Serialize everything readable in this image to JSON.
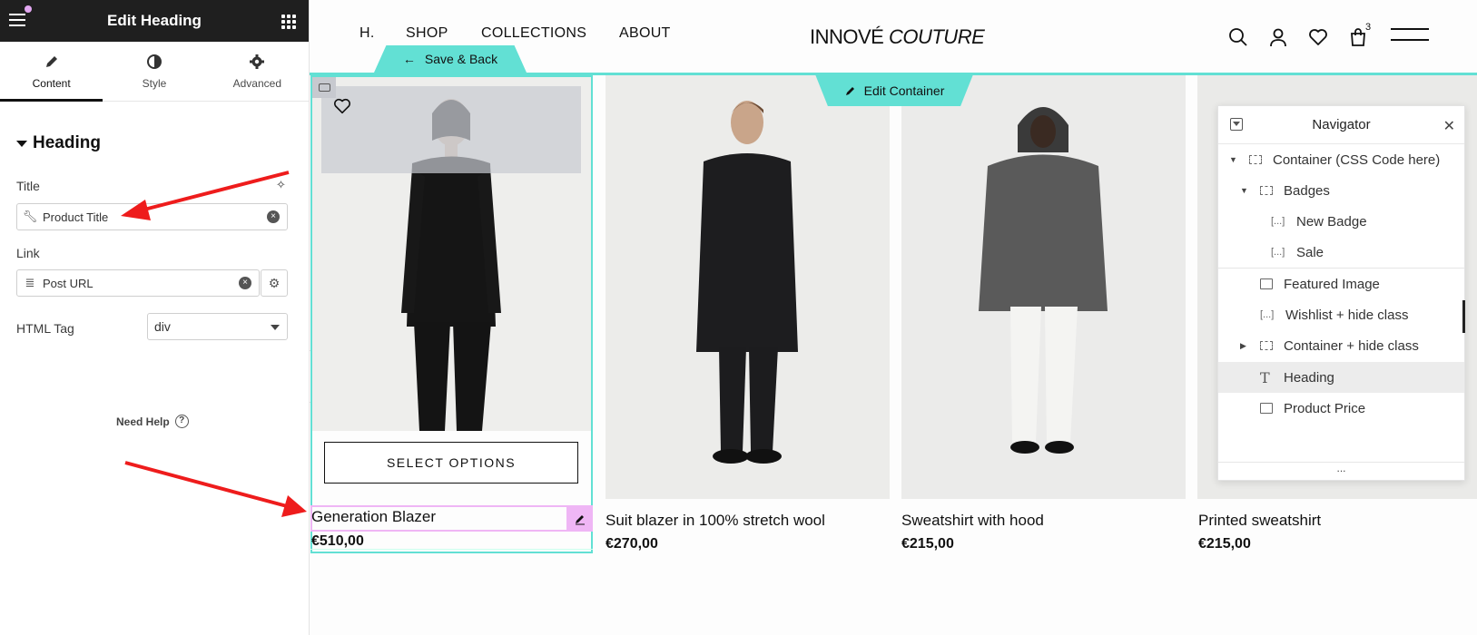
{
  "panel": {
    "title": "Edit Heading",
    "tabs": [
      {
        "label": "Content",
        "icon": "pencil-icon"
      },
      {
        "label": "Style",
        "icon": "contrast-icon"
      },
      {
        "label": "Advanced",
        "icon": "gear-icon"
      }
    ],
    "section": "Heading",
    "title_label": "Title",
    "title_value": "Product Title",
    "link_label": "Link",
    "link_value": "Post URL",
    "html_tag_label": "HTML Tag",
    "html_tag_value": "div",
    "need_help": "Need Help"
  },
  "site": {
    "nav": [
      "H.",
      "SHOP",
      "COLLECTIONS",
      "ABOUT"
    ],
    "logo_main": "INNOVÉ",
    "logo_italic": "COUTURE",
    "cart_count": "3"
  },
  "editor": {
    "save_back": "Save & Back",
    "edit_container": "Edit Container"
  },
  "products": [
    {
      "title": "Generation Blazer",
      "price": "€510,00",
      "button": "SELECT OPTIONS"
    },
    {
      "title": "Suit blazer in 100% stretch wool",
      "price": "€270,00"
    },
    {
      "title": "Sweatshirt with hood",
      "price": "€215,00"
    },
    {
      "title": "Printed sweatshirt",
      "price": "€215,00"
    }
  ],
  "navigator": {
    "title": "Navigator",
    "items": [
      {
        "label": "Container (CSS Code here)",
        "icon": "container-icon"
      },
      {
        "label": "Badges",
        "icon": "container-icon"
      },
      {
        "label": "New Badge",
        "icon": "shortcode-icon"
      },
      {
        "label": "Sale",
        "icon": "shortcode-icon"
      },
      {
        "label": "Featured Image",
        "icon": "image-icon"
      },
      {
        "label": "Wishlist + hide class",
        "icon": "shortcode-icon"
      },
      {
        "label": "Container + hide class",
        "icon": "container-icon"
      },
      {
        "label": "Heading",
        "icon": "heading-icon"
      },
      {
        "label": "Product Price",
        "icon": "price-icon"
      }
    ],
    "footer": "..."
  },
  "colors": {
    "accent_teal": "#62e0d4",
    "highlight_pink": "#efb6f5",
    "annotation_red": "#ee1c1c"
  }
}
